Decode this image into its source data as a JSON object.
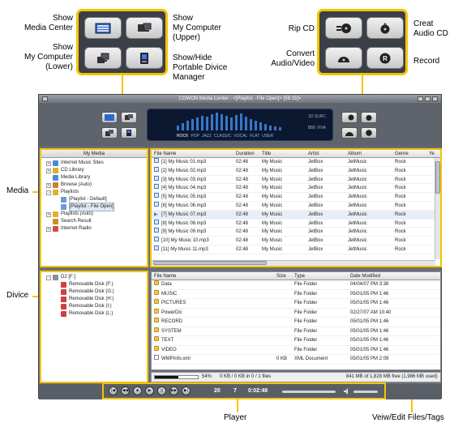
{
  "callouts": {
    "show_media_center": "Show\nMedia Center",
    "show_my_computer_upper": "Show\nMy Computer\n(Upper)",
    "show_my_computer_lower": "Show\nMy Computer\n(Lower)",
    "show_hide_portable": "Show/Hide\nPortable Divice\nManager",
    "rip_cd": "Rip CD",
    "creat_audio_cd": "Creat\nAudio CD",
    "convert": "Convert\nAudio/Video",
    "record": "Record",
    "media": "Media",
    "divice": "Divice",
    "player": "Player",
    "view_edit": "Veiw/Edit Files/Tags"
  },
  "window": {
    "title": "COWON Media Center - <[Playlist - File Open]> [56:15]>"
  },
  "display": {
    "presets": [
      "ROCK",
      "POP",
      "JAZZ",
      "CLASSIC",
      "VOCAL",
      "FLAT",
      "USER"
    ],
    "selected_preset": "ROCK",
    "knob_1": "3D SURC",
    "knob_2": "BBE VIVA"
  },
  "media_panel": {
    "header": "My Media",
    "items": [
      {
        "label": "Internet Music Sites",
        "indent": 0,
        "exp": "+",
        "icon": "globe-icon",
        "color": "#4a8ad8"
      },
      {
        "label": "CD Library",
        "indent": 0,
        "exp": "+",
        "icon": "cd-icon",
        "color": "#d8b030"
      },
      {
        "label": "Media Library",
        "indent": 0,
        "exp": "",
        "icon": "library-icon",
        "color": "#4a8ad8"
      },
      {
        "label": "Browse (Auto)",
        "indent": 0,
        "exp": "+",
        "icon": "browse-icon",
        "color": "#d08030"
      },
      {
        "label": "Playlists",
        "indent": 0,
        "exp": "-",
        "icon": "playlist-icon",
        "color": "#e0b030"
      },
      {
        "label": "[Playlist - Default]",
        "indent": 1,
        "exp": "",
        "icon": "playlist-file-icon",
        "color": "#6a9ad8"
      },
      {
        "label": "[Playlist - File Open]",
        "indent": 1,
        "exp": "",
        "icon": "playlist-file-icon",
        "color": "#6a9ad8",
        "selected": true
      },
      {
        "label": "Playlists (Auto)",
        "indent": 0,
        "exp": "+",
        "icon": "playlist-auto-icon",
        "color": "#e0b030"
      },
      {
        "label": "Search Result",
        "indent": 0,
        "exp": "",
        "icon": "search-icon",
        "color": "#c89030"
      },
      {
        "label": "Internet Radio",
        "indent": 0,
        "exp": "+",
        "icon": "radio-icon",
        "color": "#d05040"
      }
    ]
  },
  "playlist": {
    "columns": [
      "File Name",
      "Duration",
      "Title",
      "Artist",
      "Album",
      "Genre",
      "Ye"
    ],
    "rows": [
      {
        "file": "[1] My Music 01.mp3",
        "duration": "02:48",
        "title": "My Music",
        "artist": "JetBox",
        "album": "JetMusic",
        "genre": "Rock"
      },
      {
        "file": "[2] My Music 02.mp3",
        "duration": "02:48",
        "title": "My Music",
        "artist": "JetBox",
        "album": "JetMusic",
        "genre": "Rock"
      },
      {
        "file": "[3] My Music 03.mp3",
        "duration": "02:48",
        "title": "My Music",
        "artist": "JetBox",
        "album": "JetMusic",
        "genre": "Rock"
      },
      {
        "file": "[4] My Music 04.mp3",
        "duration": "02:48",
        "title": "My Music",
        "artist": "JetBox",
        "album": "JetMusic",
        "genre": "Rock"
      },
      {
        "file": "[5] My Music 05.mp3",
        "duration": "02:48",
        "title": "My Music",
        "artist": "JetBox",
        "album": "JetMusic",
        "genre": "Rock"
      },
      {
        "file": "[6] My Music 06.mp3",
        "duration": "02:48",
        "title": "My Music",
        "artist": "JetBox",
        "album": "JetMusic",
        "genre": "Rock"
      },
      {
        "file": "[7] My Music 07.mp3",
        "duration": "02:48",
        "title": "My Music",
        "artist": "JetBox",
        "album": "JetMusic",
        "genre": "Rock",
        "playing": true
      },
      {
        "file": "[8] My Music 08.mp3",
        "duration": "02:48",
        "title": "My Music",
        "artist": "JetBox",
        "album": "JetMusic",
        "genre": "Rock"
      },
      {
        "file": "[9] My Music 09.mp3",
        "duration": "02:48",
        "title": "My Music",
        "artist": "JetBox",
        "album": "JetMusic",
        "genre": "Rock"
      },
      {
        "file": "[10] My Music 10.mp3",
        "duration": "02:48",
        "title": "My Music",
        "artist": "JetBox",
        "album": "JetMusic",
        "genre": "Rock"
      },
      {
        "file": "[11] My Music 11.mp3",
        "duration": "02:48",
        "title": "My Music",
        "artist": "JetBox",
        "album": "JetMusic",
        "genre": "Rock"
      }
    ]
  },
  "device_panel": {
    "items": [
      {
        "label": "D2 [F:]",
        "indent": 0,
        "exp": "-",
        "icon": "device-icon",
        "color": "#8a8f98"
      },
      {
        "label": "Removable Disk (F:)",
        "indent": 1,
        "exp": "",
        "icon": "removable-disk-icon",
        "color": "#d04040"
      },
      {
        "label": "Removable Disk (G:)",
        "indent": 1,
        "exp": "",
        "icon": "removable-disk-icon",
        "color": "#d04040"
      },
      {
        "label": "Removable Disk (H:)",
        "indent": 1,
        "exp": "",
        "icon": "removable-disk-icon",
        "color": "#d04040"
      },
      {
        "label": "Removable Disk (I:)",
        "indent": 1,
        "exp": "",
        "icon": "removable-disk-icon",
        "color": "#d04040"
      },
      {
        "label": "Removable Disk (L:)",
        "indent": 1,
        "exp": "",
        "icon": "removable-disk-icon",
        "color": "#d04040"
      }
    ]
  },
  "files": {
    "columns": [
      "File Name",
      "Size",
      "Type",
      "Date Modified"
    ],
    "rows": [
      {
        "name": "Data",
        "size": "",
        "type": "File Folder",
        "date": "04/04/07 PM 3:38",
        "kind": "folder"
      },
      {
        "name": "MUSIC",
        "size": "",
        "type": "File Folder",
        "date": "05/01/05 PM 1:46",
        "kind": "folder"
      },
      {
        "name": "PICTURES",
        "size": "",
        "type": "File Folder",
        "date": "05/01/05 PM 1:46",
        "kind": "folder"
      },
      {
        "name": "PowerDic",
        "size": "",
        "type": "File Folder",
        "date": "02/27/07 AM 10:40",
        "kind": "folder"
      },
      {
        "name": "RECORD",
        "size": "",
        "type": "File Folder",
        "date": "05/01/05 PM 1:46",
        "kind": "folder"
      },
      {
        "name": "SYSTEM",
        "size": "",
        "type": "File Folder",
        "date": "05/01/05 PM 1:46",
        "kind": "folder"
      },
      {
        "name": "TEXT",
        "size": "",
        "type": "File Folder",
        "date": "05/01/05 PM 1:46",
        "kind": "folder"
      },
      {
        "name": "VIDEO",
        "size": "",
        "type": "File Folder",
        "date": "05/01/05 PM 1:46",
        "kind": "folder"
      },
      {
        "name": "WMPInfo.xml",
        "size": "0 KB",
        "type": "XML Document",
        "date": "05/01/05 PM 2:09",
        "kind": "file"
      }
    ]
  },
  "status": {
    "progress_percent": 54,
    "percent_text": "54%",
    "transfer_text": "0 KB / 0 KB in 0 / 1 files",
    "disk_text": "841 MB of 1,828 MB free (1,986 MB used)"
  },
  "player": {
    "track_number": "20",
    "track_index": "7",
    "time": "0:02:48",
    "buttons": [
      "|◀",
      "◀◀",
      "■",
      "▶",
      "||",
      "▶▶",
      "▶|"
    ]
  },
  "colors": {
    "callout_yellow": "#f5c400",
    "window_gray": "#6a6f78",
    "display_blue": "#0c1830"
  }
}
